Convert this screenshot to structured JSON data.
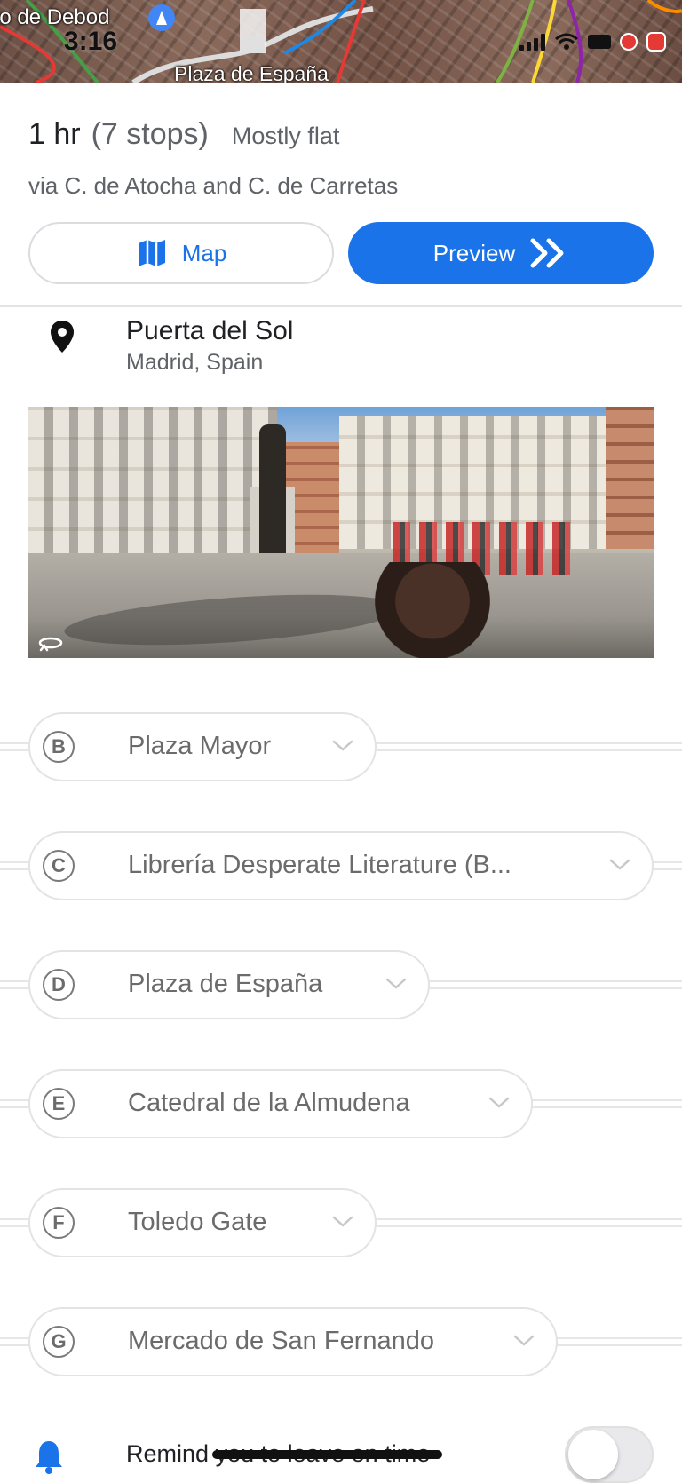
{
  "map": {
    "place_label": "lo de Debod",
    "plaza_label": "Plaza de España"
  },
  "status_bar": {
    "time": "3:16"
  },
  "summary": {
    "duration": "1 hr",
    "stops": "(7 stops)",
    "terrain": "Mostly flat",
    "via": "via C. de Atocha and C. de Carretas"
  },
  "buttons": {
    "map_label": "Map",
    "preview_label": "Preview"
  },
  "start": {
    "name": "Puerta del Sol",
    "subtitle": "Madrid, Spain"
  },
  "stops": [
    {
      "letter": "B",
      "name": "Plaza Mayor"
    },
    {
      "letter": "C",
      "name": "Librería Desperate Literature (B..."
    },
    {
      "letter": "D",
      "name": "Plaza de España"
    },
    {
      "letter": "E",
      "name": "Catedral de la Almudena"
    },
    {
      "letter": "F",
      "name": "Toledo Gate"
    },
    {
      "letter": "G",
      "name": "Mercado de San Fernando"
    }
  ],
  "remind": {
    "label": "Remind",
    "struck_text": "you to leave on time",
    "enabled": false
  },
  "colors": {
    "accent": "#1a73e8",
    "secondary_text": "#5f6368"
  }
}
